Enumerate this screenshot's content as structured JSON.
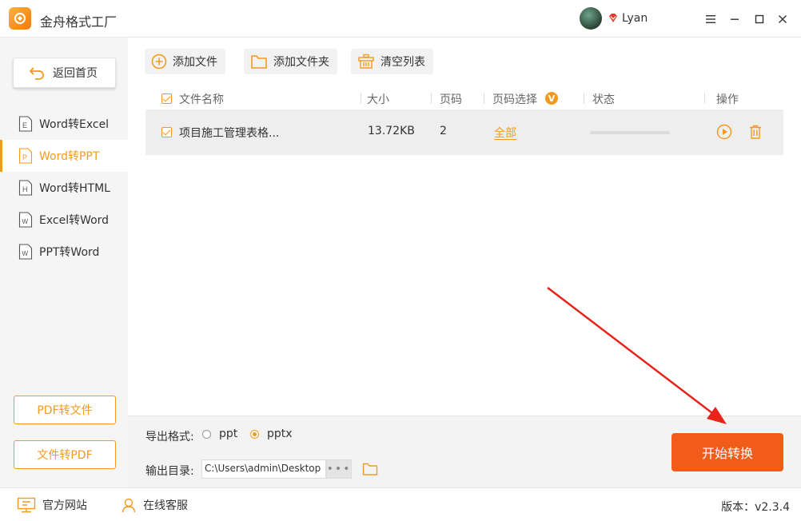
{
  "app": {
    "title": "金舟格式工厂",
    "username": "Lyan"
  },
  "sidebar": {
    "home_label": "返回首页",
    "items": [
      {
        "label": "Word转Excel",
        "icon_letter": "E"
      },
      {
        "label": "Word转PPT",
        "icon_letter": "P"
      },
      {
        "label": "Word转HTML",
        "icon_letter": "H"
      },
      {
        "label": "Excel转Word",
        "icon_letter": "W"
      },
      {
        "label": "PPT转Word",
        "icon_letter": "W"
      }
    ],
    "active_item": "Word转PPT",
    "pdf_to_file": "PDF转文件",
    "file_to_pdf": "文件转PDF"
  },
  "toolbar": {
    "add_file": "添加文件",
    "add_folder": "添加文件夹",
    "clear_list": "清空列表"
  },
  "table": {
    "columns": [
      "文件名称",
      "大小",
      "页码",
      "页码选择",
      "状态",
      "操作"
    ],
    "page_select_badge": "V",
    "rows": [
      {
        "name": "项目施工管理表格...",
        "size": "13.72KB",
        "pages": "2",
        "page_select": "全部",
        "progress": 0
      }
    ]
  },
  "options": {
    "format_label": "导出格式:",
    "formats": [
      "ppt",
      "pptx"
    ],
    "selected_format": "pptx",
    "output_label": "输出目录:",
    "output_path": "C:\\Users\\admin\\Desktop",
    "browse_dots": "•••",
    "start_button": "开始转换"
  },
  "statusbar": {
    "website": "官方网站",
    "support": "在线客服",
    "version": "版本：v2.3.4"
  },
  "colors": {
    "accent": "#f39a1e",
    "start_button": "#f25c1a",
    "annotation_arrow": "#e8231a"
  },
  "icons": {
    "logo": "app-logo-icon",
    "vip": "vip-diamond-icon",
    "add_file": "plus-circle-icon",
    "add_folder": "folder-icon",
    "clear": "basket-icon",
    "play": "play-circle-icon",
    "delete": "trash-icon",
    "home": "return-arrow-icon",
    "website": "monitor-icon",
    "support": "headset-icon"
  }
}
